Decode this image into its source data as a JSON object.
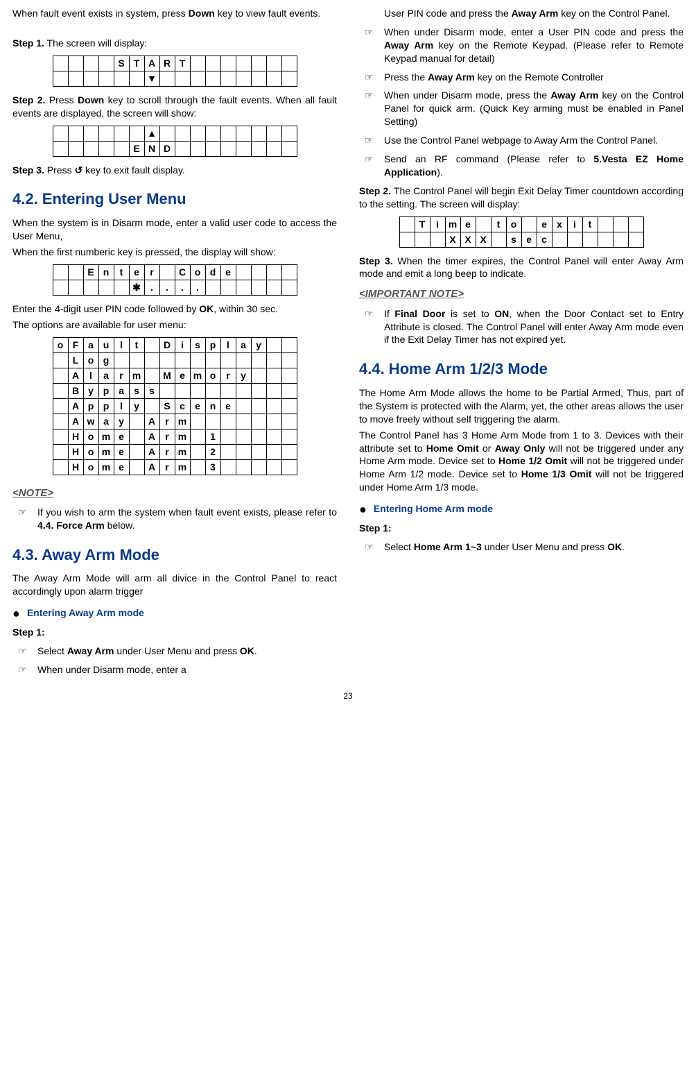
{
  "left": {
    "intro": "When fault event exists in system, press ",
    "intro_b": "Down",
    "intro2": " key to view fault events.",
    "step1_label": "Step 1.",
    "step1_text": " The screen will display:",
    "lcd_start_rows": [
      [
        " ",
        " ",
        " ",
        " ",
        "S",
        "T",
        "A",
        "R",
        "T",
        " ",
        " ",
        " ",
        " ",
        " ",
        " ",
        " "
      ],
      [
        " ",
        " ",
        " ",
        " ",
        " ",
        " ",
        "▼",
        " ",
        " ",
        " ",
        " ",
        " ",
        " ",
        " ",
        " ",
        " "
      ]
    ],
    "step2_label": "Step 2.",
    "step2_text_a": " Press ",
    "step2_text_b": "Down",
    "step2_text_c": " key to scroll through the fault events. When all fault events are displayed, the screen will show:",
    "lcd_end_rows": [
      [
        " ",
        " ",
        " ",
        " ",
        " ",
        " ",
        "▲",
        " ",
        " ",
        " ",
        " ",
        " ",
        " ",
        " ",
        " ",
        " "
      ],
      [
        " ",
        " ",
        " ",
        " ",
        " ",
        "E",
        "N",
        "D",
        " ",
        " ",
        " ",
        " ",
        " ",
        " ",
        " ",
        " "
      ]
    ],
    "step3_label": "Step 3.",
    "step3_text_a": " Press ",
    "step3_icon": "↺",
    "step3_text_b": " key to exit fault display.",
    "s42_title": "4.2. Entering User Menu",
    "s42_p1": "When the system is in Disarm mode, enter a valid user code to access the User Menu,",
    "s42_p2": "When the first numberic key is pressed, the display will show:",
    "lcd_enter_rows": [
      [
        " ",
        " ",
        "E",
        "n",
        "t",
        "e",
        "r",
        " ",
        "C",
        "o",
        "d",
        "e",
        " ",
        " ",
        " ",
        " "
      ],
      [
        " ",
        " ",
        " ",
        " ",
        " ",
        "✱",
        ".",
        ".",
        ".",
        ".",
        "",
        "",
        "",
        "",
        "",
        ""
      ]
    ],
    "s42_p3_a": "Enter the 4-digit user PIN code followed by ",
    "s42_p3_b": "OK",
    "s42_p3_c": ", within 30 sec.",
    "s42_p4": "The options are available for user menu:",
    "lcd_menu_rows": [
      [
        "o",
        "F",
        "a",
        "u",
        "l",
        "t",
        " ",
        "D",
        "i",
        "s",
        "p",
        "l",
        "a",
        "y",
        " ",
        " "
      ],
      [
        " ",
        "L",
        "o",
        "g",
        " ",
        " ",
        " ",
        " ",
        " ",
        " ",
        " ",
        " ",
        " ",
        " ",
        " ",
        " "
      ],
      [
        " ",
        "A",
        "l",
        "a",
        "r",
        "m",
        " ",
        "M",
        "e",
        "m",
        "o",
        "r",
        "y",
        " ",
        " ",
        " "
      ],
      [
        " ",
        "B",
        "y",
        "p",
        "a",
        "s",
        "s",
        " ",
        " ",
        " ",
        " ",
        " ",
        " ",
        " ",
        " ",
        " "
      ],
      [
        " ",
        "A",
        "p",
        "p",
        "l",
        "y",
        " ",
        "S",
        "c",
        "e",
        "n",
        "e",
        " ",
        " ",
        " ",
        " "
      ],
      [
        " ",
        "A",
        "w",
        "a",
        "y",
        " ",
        "A",
        "r",
        "m",
        " ",
        " ",
        " ",
        " ",
        " ",
        " ",
        " "
      ],
      [
        " ",
        "H",
        "o",
        "m",
        "e",
        " ",
        "A",
        "r",
        "m",
        " ",
        "1",
        " ",
        " ",
        " ",
        " ",
        " "
      ],
      [
        " ",
        "H",
        "o",
        "m",
        "e",
        " ",
        "A",
        "r",
        "m",
        " ",
        "2",
        " ",
        " ",
        " ",
        " ",
        " "
      ],
      [
        " ",
        "H",
        "o",
        "m",
        "e",
        " ",
        "A",
        "r",
        "m",
        " ",
        "3",
        " ",
        " ",
        " ",
        " ",
        " "
      ]
    ],
    "note_head": "<NOTE>",
    "note_text_a": "If you wish to arm the system when fault event exists, please refer to ",
    "note_text_b": "4.4. Force Arm",
    "note_text_c": " below.",
    "s43_title": "4.3. Away Arm Mode",
    "s43_p1": "The Away Arm Mode will arm all divice in the Control Panel to react accordingly upon alarm trigger",
    "s43_bullet": "Entering Away Arm mode",
    "s43_step1": "Step 1:",
    "s43_h1_a": "Select ",
    "s43_h1_b": "Away Arm",
    "s43_h1_c": " under User Menu and press ",
    "s43_h1_d": "OK",
    "s43_h1_e": ".",
    "s43_h2": "When under Disarm mode, enter a "
  },
  "right": {
    "r1_a": "User PIN code and press the ",
    "r1_b": "Away Arm",
    "r1_c": " key on the Control Panel.",
    "r2_a": "When under Disarm mode, enter a User PIN code and press the ",
    "r2_b": "Away Arm",
    "r2_c": " key on the Remote Keypad. (Please refer to Remote Keypad manual for detail)",
    "r3_a": "Press the ",
    "r3_b": "Away Arm",
    "r3_c": " key on the Remote Controller",
    "r4_a": "When under Disarm mode, press the ",
    "r4_b": "Away Arm",
    "r4_c": " key on the Control Panel for quick arm. (Quick Key arming must be enabled in Panel Setting)",
    "r5": "Use the Control Panel webpage to Away Arm the Control Panel.",
    "r6_a": "Send an RF command (Please refer to ",
    "r6_b": "5.Vesta EZ Home Application",
    "r6_c": ").",
    "step2_label": "Step 2.",
    "step2_text": "  The Control Panel will begin Exit Delay Timer countdown according to the setting. The screen will display:",
    "lcd_timer_rows": [
      [
        " ",
        "T",
        "i",
        "m",
        "e",
        " ",
        "t",
        "o",
        " ",
        "e",
        "x",
        "i",
        "t",
        " ",
        " ",
        " "
      ],
      [
        " ",
        " ",
        " ",
        "X",
        "X",
        "X",
        " ",
        "s",
        "e",
        "c",
        " ",
        " ",
        " ",
        " ",
        " ",
        " "
      ]
    ],
    "step3_label": "Step 3.",
    "step3_text": " When the timer expires, the Control Panel will enter Away Arm mode and emit a long beep to indicate.",
    "imp_head": "<IMPORTANT NOTE>",
    "imp_a": "If ",
    "imp_b": "Final Door",
    "imp_c": " is set to ",
    "imp_d": "ON",
    "imp_e": ", when the Door Contact set to Entry Attribute is closed. The Control Panel will enter Away Arm mode even if the Exit Delay Timer has not expired yet.",
    "s44_title": "4.4. Home Arm 1/2/3 Mode",
    "s44_p1": "The Home Arm Mode allows the home to be Partial Armed, Thus, part of the System is protected with the Alarm, yet, the other areas allows the user to move freely without self triggering the alarm.",
    "s44_p2_a": "The Control Panel has 3 Home Arm Mode from 1 to 3. Devices with their attribute set to ",
    "s44_p2_b": "Home Omit",
    "s44_p2_c": " or ",
    "s44_p2_d": "Away Only",
    "s44_p2_e": " will not be triggered under any Home Arm mode. Device set to ",
    "s44_p2_f": "Home 1/2 Omit",
    "s44_p2_g": " will not be triggered under Home Arm 1/2 mode. Device set to ",
    "s44_p2_h": "Home 1/3 Omit",
    "s44_p2_i": " will not be triggered under Home Arm 1/3 mode.",
    "s44_bullet": "Entering Home Arm mode",
    "s44_step1": "Step 1:",
    "s44_h1_a": "Select ",
    "s44_h1_b": "Home Arm 1~3",
    "s44_h1_c": " under User Menu and press ",
    "s44_h1_d": "OK",
    "s44_h1_e": "."
  },
  "pageno": "23"
}
